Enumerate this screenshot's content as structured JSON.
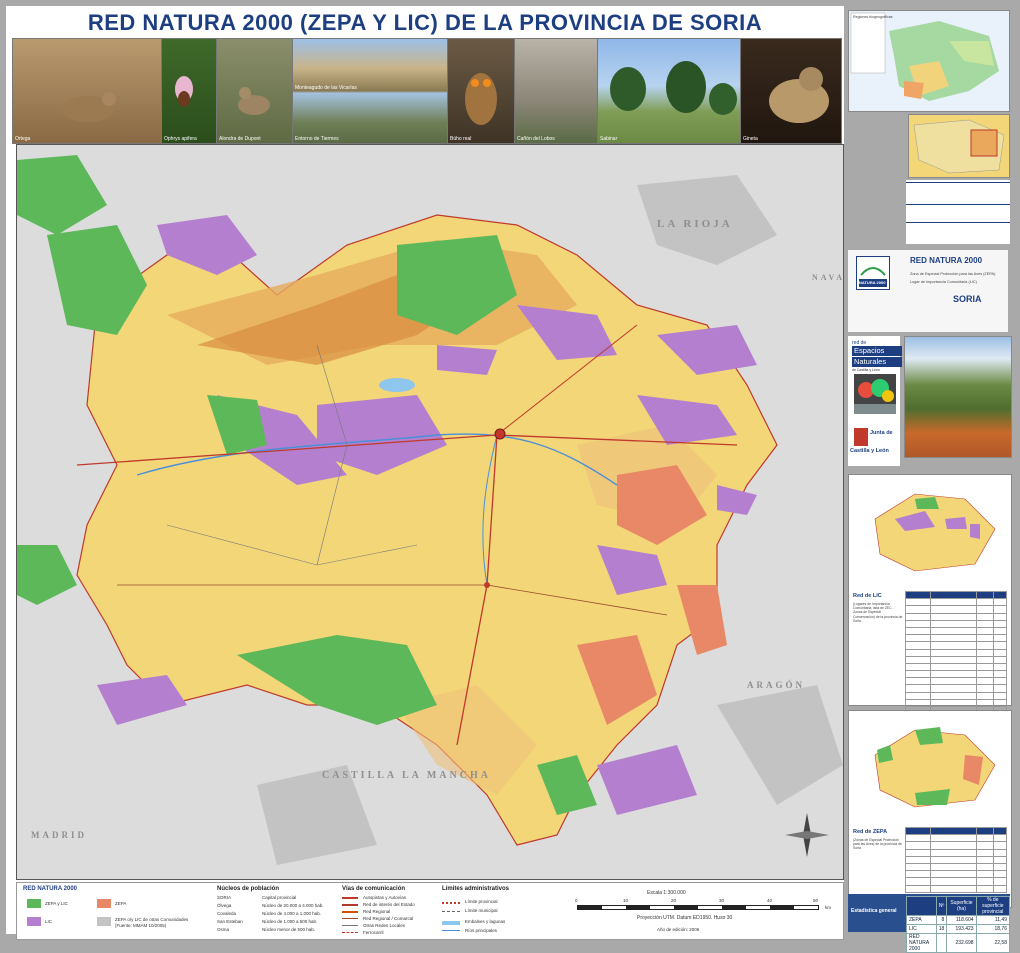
{
  "title": "RED NATURA 2000 (ZEPA Y LIC) DE LA PROVINCIA DE SORIA",
  "photos": [
    {
      "caption": "Ortega"
    },
    {
      "caption": "Ophrys apifera"
    },
    {
      "caption": "Alondra de Dupont"
    },
    {
      "caption": "Entorno de Tiermes"
    },
    {
      "caption": "Búho real"
    },
    {
      "caption": "Cañón del Lobos"
    },
    {
      "caption": "Sabinar"
    },
    {
      "caption": "Gineta"
    }
  ],
  "photo_overlay": "Monteagudo de las Vicarías",
  "map": {
    "region_labels": {
      "la_rioja": "LA RIOJA",
      "navarra": "NAVARRA",
      "aragon": "ARAGÓN",
      "castilla": "CASTILLA",
      "la_mancha": "LA MANCHA",
      "madrid": "MADRID"
    }
  },
  "legend": {
    "title": "RED NATURA 2000",
    "zepa_lic": "ZEPA y LIC",
    "zepa": "ZEPA",
    "lic": "LIC",
    "zepa_outside": "ZEPA o/y LIC de otras Comunidades",
    "source": "(Fuente: MMAM 10/2005)",
    "nucleos_title": "Núcleos de población",
    "nucleos": [
      {
        "symbol": "SORIA",
        "label": "Capital provincial"
      },
      {
        "symbol": "Ólvega",
        "label": "Núcleo de 20.000 a 4.000 hab."
      },
      {
        "symbol": "Covaleda",
        "label": "Núcleo de 4.000 a 1.000 hab."
      },
      {
        "symbol": "San Esteban",
        "label": "Núcleo de 1.000 a 500 hab."
      },
      {
        "symbol": "Osma",
        "label": "Núcleo menor de 500 hab."
      }
    ],
    "vias_title": "Vías de comunicación",
    "vias": [
      "Autopistas y Autovías",
      "Red de interés del Estado",
      "Red Regional",
      "Red Regional / Comarcal",
      "Otras Redes Locales",
      "Ferrocarril"
    ],
    "limites_title": "Límites administrativos",
    "limites": [
      "Límite provincial",
      "Límite municipal"
    ],
    "hidro": [
      "Embalses y lagunas",
      "Ríos principales"
    ],
    "scale": "Escala 1:300.000",
    "scale_ticks": [
      "0",
      "10",
      "20",
      "30",
      "40",
      "50"
    ],
    "scale_unit": "km",
    "projection": "Proyección UTM. Datum ED1950. Huso 30",
    "edition": "Año de edición: 2006"
  },
  "side": {
    "europe_legend_title": "Regiones biogeográficas",
    "red_natura_title": "RED NATURA 2000",
    "zepa_subtitle": "Zona de Especial Protección para las Aves (ZEPA)",
    "lic_subtitle": "Lugar de Importancia Comunitaria (LIC)",
    "soria": "SORIA",
    "natura_logo": "NATURA 2000",
    "red_de": "red de",
    "espacios": "Espacios",
    "naturales": "Naturales",
    "de_cyl": "de Castilla y León",
    "junta": "Junta de",
    "castilla_leon": "Castilla y León",
    "lic_box_title": "Red de LIC",
    "lic_box_subtitle": "(Lugares de Importancia Comunitaria, lista de ZEC - Zonas de Especial Conservación) de la provincia de Soria",
    "zepa_box_title": "Red de ZEPA",
    "zepa_box_subtitle": "(Zonas de Especial Protección para las Aves) de la provincia de Soria",
    "stats_title": "Estadística general",
    "stats_header": [
      "",
      "Nº",
      "Superficie (ha)",
      "% de superficie provincial"
    ],
    "stats_rows": [
      [
        "ZEPA",
        "8",
        "118.604",
        "11,49"
      ],
      [
        "LIC",
        "18",
        "193.423",
        "18,76"
      ],
      [
        "RED NATURA 2000",
        "",
        "232.698",
        "22,58"
      ]
    ]
  },
  "colors": {
    "title_blue": "#1d3f82",
    "zepa_lic": "#5db85a",
    "zepa": "#e88866",
    "lic": "#b47fce",
    "province": "#f2d678",
    "mountains": "#d9903d",
    "outside": "#d6d6d6"
  }
}
